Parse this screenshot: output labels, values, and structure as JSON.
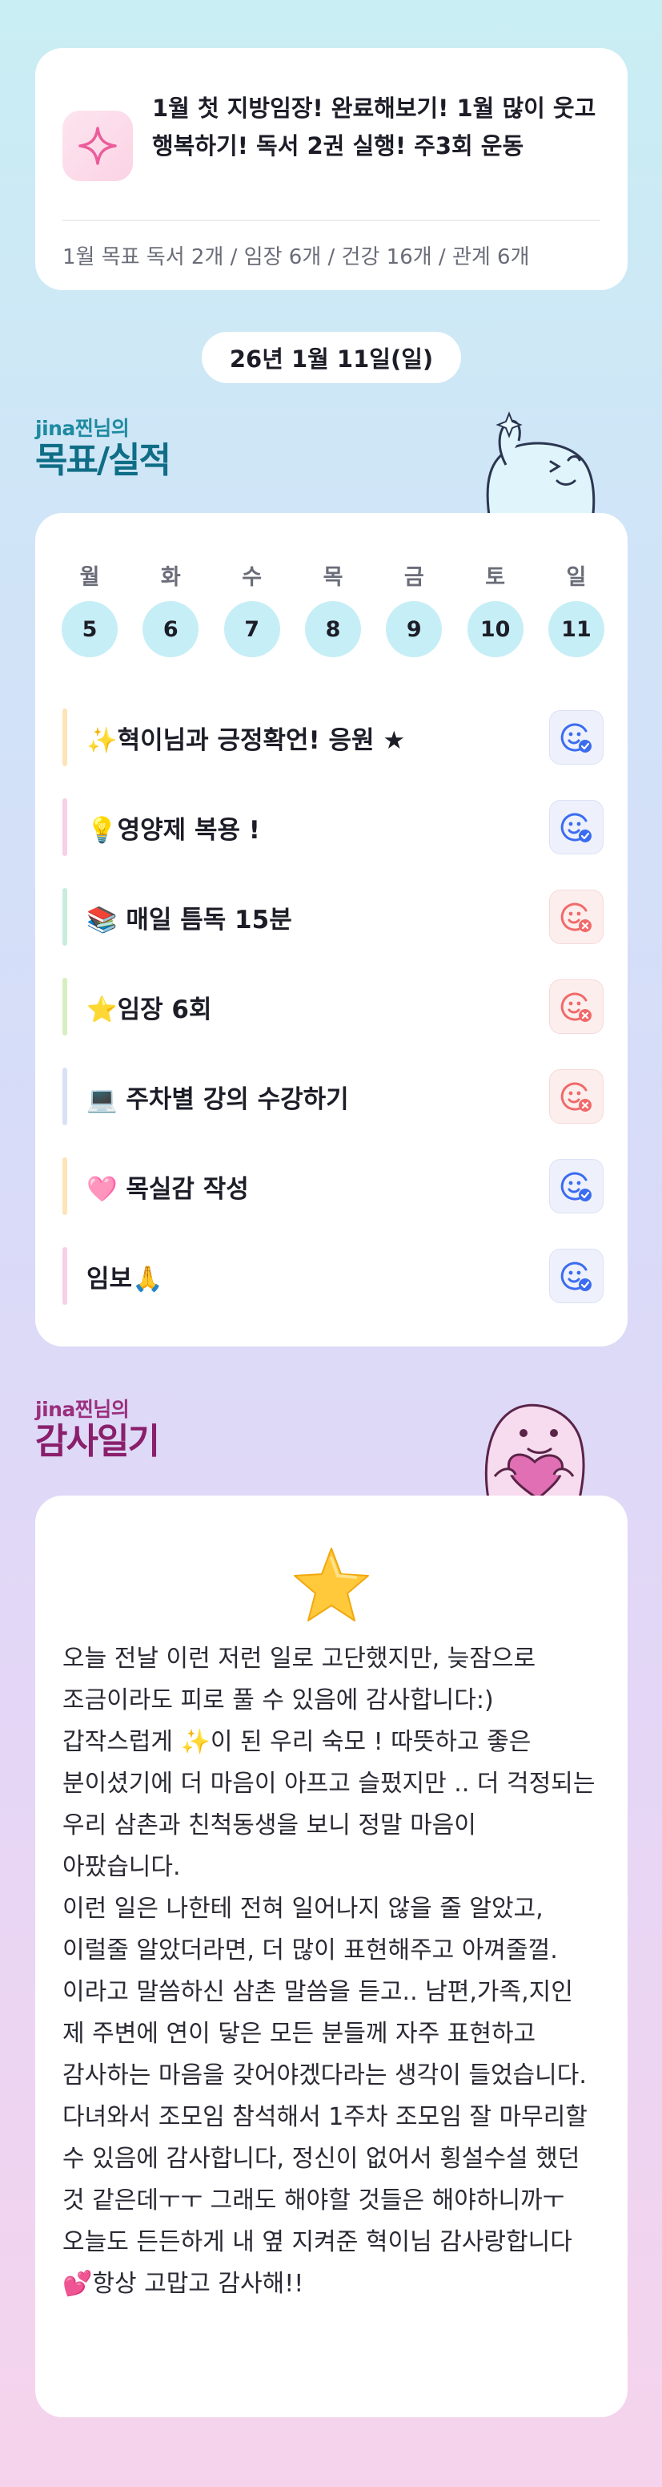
{
  "monthly_goal": {
    "text": "1월 첫 지방임장! 완료해보기! 1월 많이 웃고 행복하기! 독서 2권 실행! 주3회 운동",
    "summary": "1월 목표  독서 2개 / 임장 6개 / 건강 16개 / 관계 6개"
  },
  "date_label": "26년 1월 11일(일)",
  "goals_section": {
    "subtitle": "jina찐님의",
    "title": "목표/실적"
  },
  "week": [
    {
      "day": "월",
      "date": "5"
    },
    {
      "day": "화",
      "date": "6"
    },
    {
      "day": "수",
      "date": "7"
    },
    {
      "day": "목",
      "date": "8"
    },
    {
      "day": "금",
      "date": "9"
    },
    {
      "day": "토",
      "date": "10"
    },
    {
      "day": "일",
      "date": "11"
    }
  ],
  "goals": [
    {
      "label": "✨혁이님과 긍정확언! 응원 ★",
      "status": "done",
      "bar_color": "#fde4b8"
    },
    {
      "label": "💡영양제 복용 !",
      "status": "done",
      "bar_color": "#f8cfe6"
    },
    {
      "label": "📚 매일 틈독 15분",
      "status": "fail",
      "bar_color": "#c7eedc"
    },
    {
      "label": "⭐임장 6회",
      "status": "fail",
      "bar_color": "#d6efc0"
    },
    {
      "label": "💻 주차별 강의 수강하기",
      "status": "fail",
      "bar_color": "#d9e1f6"
    },
    {
      "label": "🩷 목실감 작성",
      "status": "done",
      "bar_color": "#fde4b8"
    },
    {
      "label": "임보🙏",
      "status": "done",
      "bar_color": "#f8cfe6"
    }
  ],
  "thanks_section": {
    "subtitle": "jina찐님의",
    "title": "감사일기"
  },
  "thanks_text": "오늘 전날 이런 저런 일로 고단했지만, 늦잠으로 조금이라도 피로 풀 수 있음에 감사합니다:)\n갑작스럽게 ✨이 된 우리 숙모 ! 따뜻하고 좋은 분이셨기에 더 마음이 아프고 슬펐지만 .. 더 걱정되는 우리 삼촌과 친척동생을 보니 정말 마음이 아팠습니다.\n이런 일은 나한테 전혀 일어나지 않을 줄 알았고, 이럴줄 알았더라면, 더 많이 표현해주고 아껴줄껄.  이라고 말씀하신 삼촌 말씀을 듣고.. 남편,가족,지인 제 주변에 연이 닿은 모든 분들께 자주 표현하고 감사하는 마음을 갖어야겠다라는 생각이 들었습니다.\n다녀와서 조모임 참석해서 1주차 조모임 잘 마무리할  수 있음에 감사합니다, 정신이 없어서 횡설수설 했던 것 같은데ㅜㅜ 그래도 해야할 것들은 해야하니까ㅜ 오늘도 든든하게 내 옆 지켜준 혁이님 감사랑합니다💕항상 고맙고 감사해!!",
  "colors": {
    "done_icon": "#3b6cf0",
    "fail_icon": "#f06a6a",
    "day_circle": "#c6eef6"
  },
  "icons": {
    "goal_icon": "sparkle-icon",
    "done": "smile-check-icon",
    "fail": "smile-x-icon",
    "thanks_star": "star-icon"
  }
}
